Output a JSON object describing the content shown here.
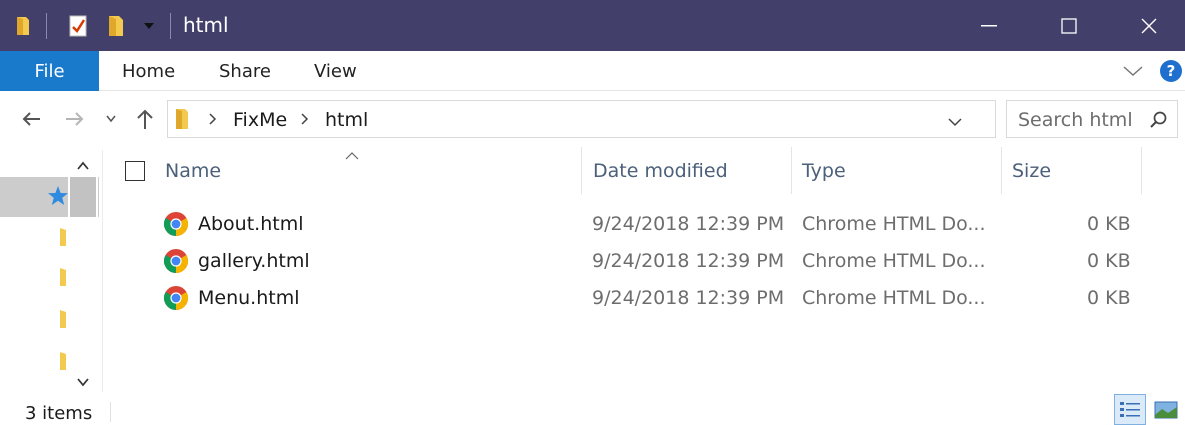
{
  "window": {
    "title": "html",
    "controls": [
      "minimize-icon",
      "maximize-icon",
      "close-icon"
    ],
    "quick_access": [
      "folder-icon",
      "properties-icon",
      "new-folder-icon",
      "dropdown-icon"
    ]
  },
  "ribbon": {
    "file_label": "File",
    "tabs": [
      "Home",
      "Share",
      "View"
    ],
    "help_label": "?"
  },
  "address": {
    "crumbs": [
      "FixMe",
      "html"
    ],
    "search_placeholder": "Search html"
  },
  "headers": {
    "name": "Name",
    "date": "Date modified",
    "type": "Type",
    "size": "Size"
  },
  "files": [
    {
      "name": "About.html",
      "date": "9/24/2018 12:39 PM",
      "type": "Chrome HTML Do...",
      "size": "0 KB"
    },
    {
      "name": "gallery.html",
      "date": "9/24/2018 12:39 PM",
      "type": "Chrome HTML Do...",
      "size": "0 KB"
    },
    {
      "name": "Menu.html",
      "date": "9/24/2018 12:39 PM",
      "type": "Chrome HTML Do...",
      "size": "0 KB"
    }
  ],
  "status": {
    "item_count": "3 items"
  },
  "colors": {
    "titlebar": "#423f6a",
    "file_tab": "#1979ca",
    "header_text": "#4c607a"
  }
}
